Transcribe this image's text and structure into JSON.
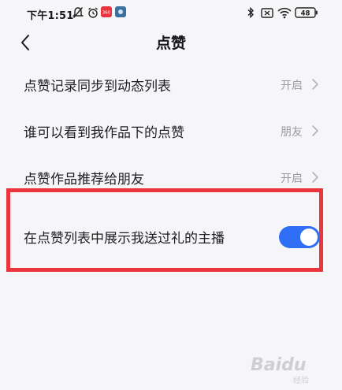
{
  "status_bar": {
    "time": "下午1:51",
    "app_badge_text": "360",
    "battery_level": "48",
    "icons": [
      "mute-bell-icon",
      "alarm-icon",
      "app-badge-icon",
      "app-square-icon",
      "bluetooth-icon",
      "sim-x-icon",
      "wifi-icon",
      "battery-icon"
    ]
  },
  "nav": {
    "back_icon": "chevron-left-icon",
    "title": "点赞"
  },
  "settings": [
    {
      "label": "点赞记录同步到动态列表",
      "value": "开启"
    },
    {
      "label": "谁可以看到我作品下的点赞",
      "value": "朋友"
    },
    {
      "label": "点赞作品推荐给朋友",
      "value": "开启"
    }
  ],
  "toggle_setting": {
    "label": "在点赞列表中展示我送过礼的主播",
    "checked": true
  },
  "colors": {
    "accent": "#2e6ff6",
    "highlight": "#e9353b",
    "background": "#f6f6f8",
    "secondary_text": "#9a9aa0"
  },
  "watermark": {
    "main": "Baidu",
    "sub": "经验"
  }
}
